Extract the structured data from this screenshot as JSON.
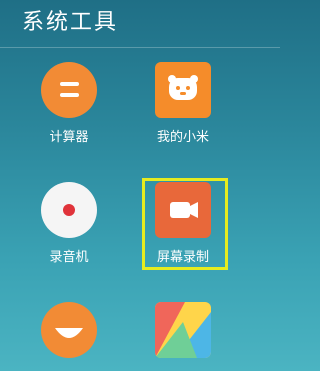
{
  "folder": {
    "title": "系统工具"
  },
  "apps": [
    {
      "id": "calculator",
      "label": "计算器",
      "icon": "calculator-icon",
      "color": "#f28b35"
    },
    {
      "id": "mi",
      "label": "我的小米",
      "icon": "mi-bear-icon",
      "color": "#f58c2a"
    },
    {
      "id": "recorder",
      "label": "录音机",
      "icon": "record-icon",
      "color": "#f5f5f5"
    },
    {
      "id": "screen-recorder",
      "label": "屏幕录制",
      "icon": "video-camera-icon",
      "color": "#e8683a"
    },
    {
      "id": "face-app",
      "label": "",
      "icon": "smile-face-icon",
      "color": "#f28b35"
    },
    {
      "id": "theme-app",
      "label": "",
      "icon": "theme-icon",
      "color": "#4db6e6"
    }
  ],
  "highlight": {
    "target": "screen-recorder",
    "color": "#e6ec1f"
  }
}
